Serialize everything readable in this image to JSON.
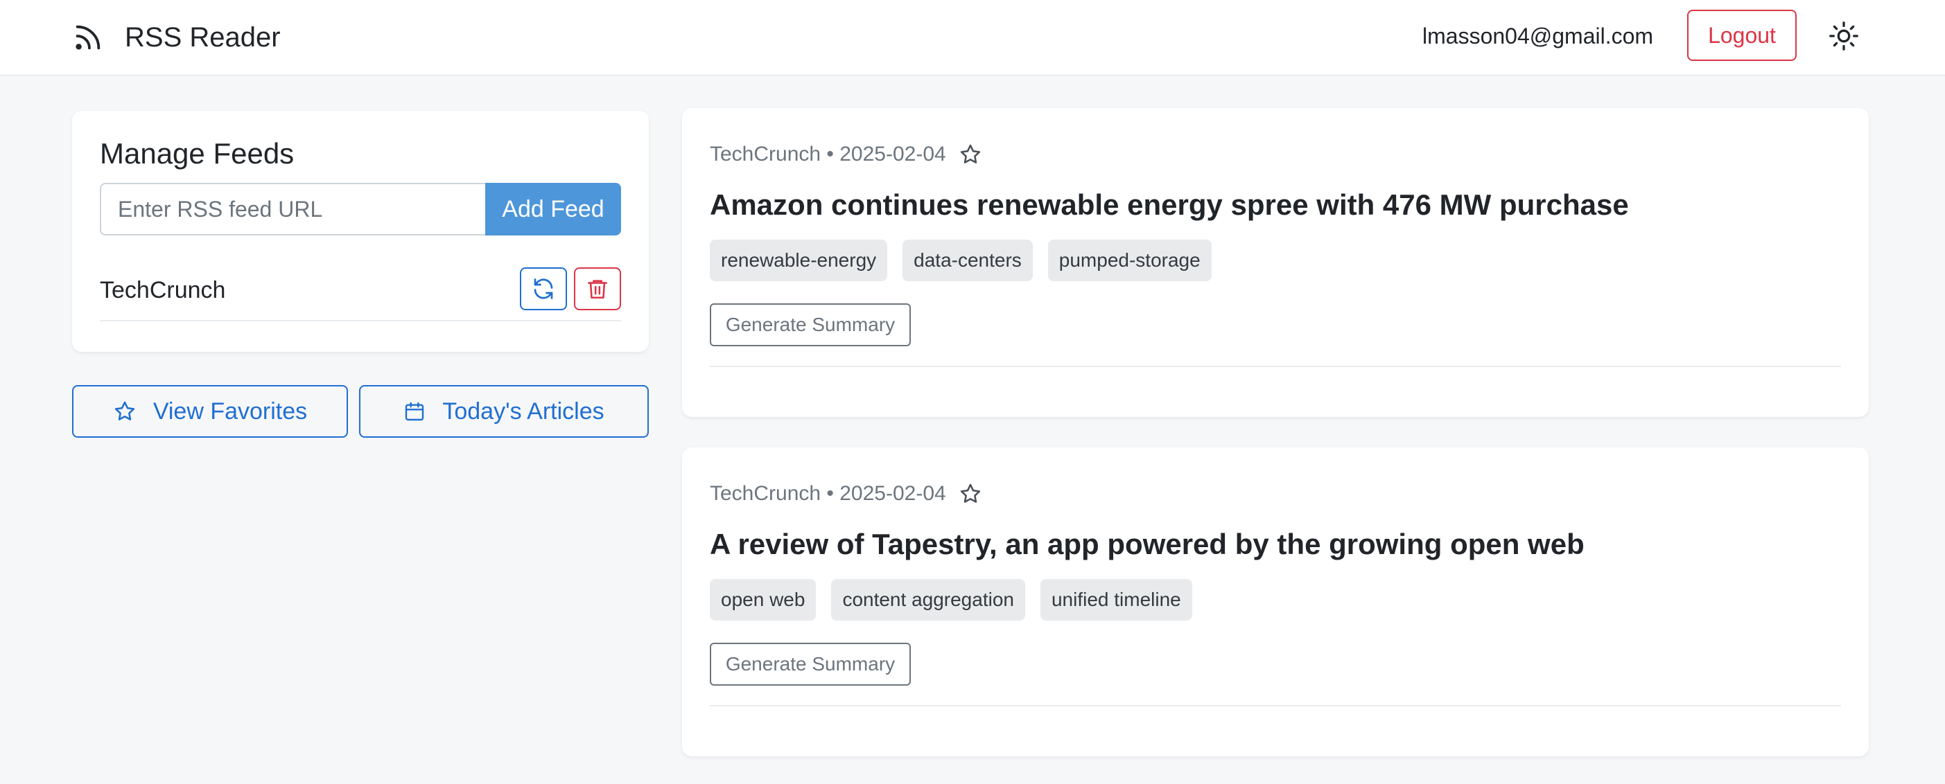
{
  "header": {
    "brand_title": "RSS Reader",
    "brand_icon": "rss-icon",
    "user_email": "lmasson04@gmail.com",
    "logout_label": "Logout",
    "theme_icon": "sun-icon"
  },
  "manage_feeds": {
    "title": "Manage Feeds",
    "input_placeholder": "Enter RSS feed URL",
    "input_value": "",
    "add_label": "Add Feed",
    "feeds": [
      {
        "name": "TechCrunch",
        "refresh_icon": "refresh-icon",
        "delete_icon": "trash-icon"
      }
    ]
  },
  "nav": {
    "favorites_label": "View Favorites",
    "favorites_icon": "star-icon",
    "today_label": "Today's Articles",
    "today_icon": "calendar-icon"
  },
  "articles": [
    {
      "meta": "TechCrunch • 2025-02-04",
      "title": "Amazon continues renewable energy spree with 476 MW purchase",
      "tags": [
        "renewable-energy",
        "data-centers",
        "pumped-storage"
      ],
      "summary_label": "Generate Summary"
    },
    {
      "meta": "TechCrunch • 2025-02-04",
      "title": "A review of Tapestry, an app powered by the growing open web",
      "tags": [
        "open web",
        "content aggregation",
        "unified timeline"
      ],
      "summary_label": "Generate Summary"
    }
  ],
  "colors": {
    "primary": "#1f6fd1",
    "add_button": "#4d96d9",
    "danger": "#dc3545",
    "background": "#f6f7f9",
    "tag_bg": "#e9eaec"
  }
}
